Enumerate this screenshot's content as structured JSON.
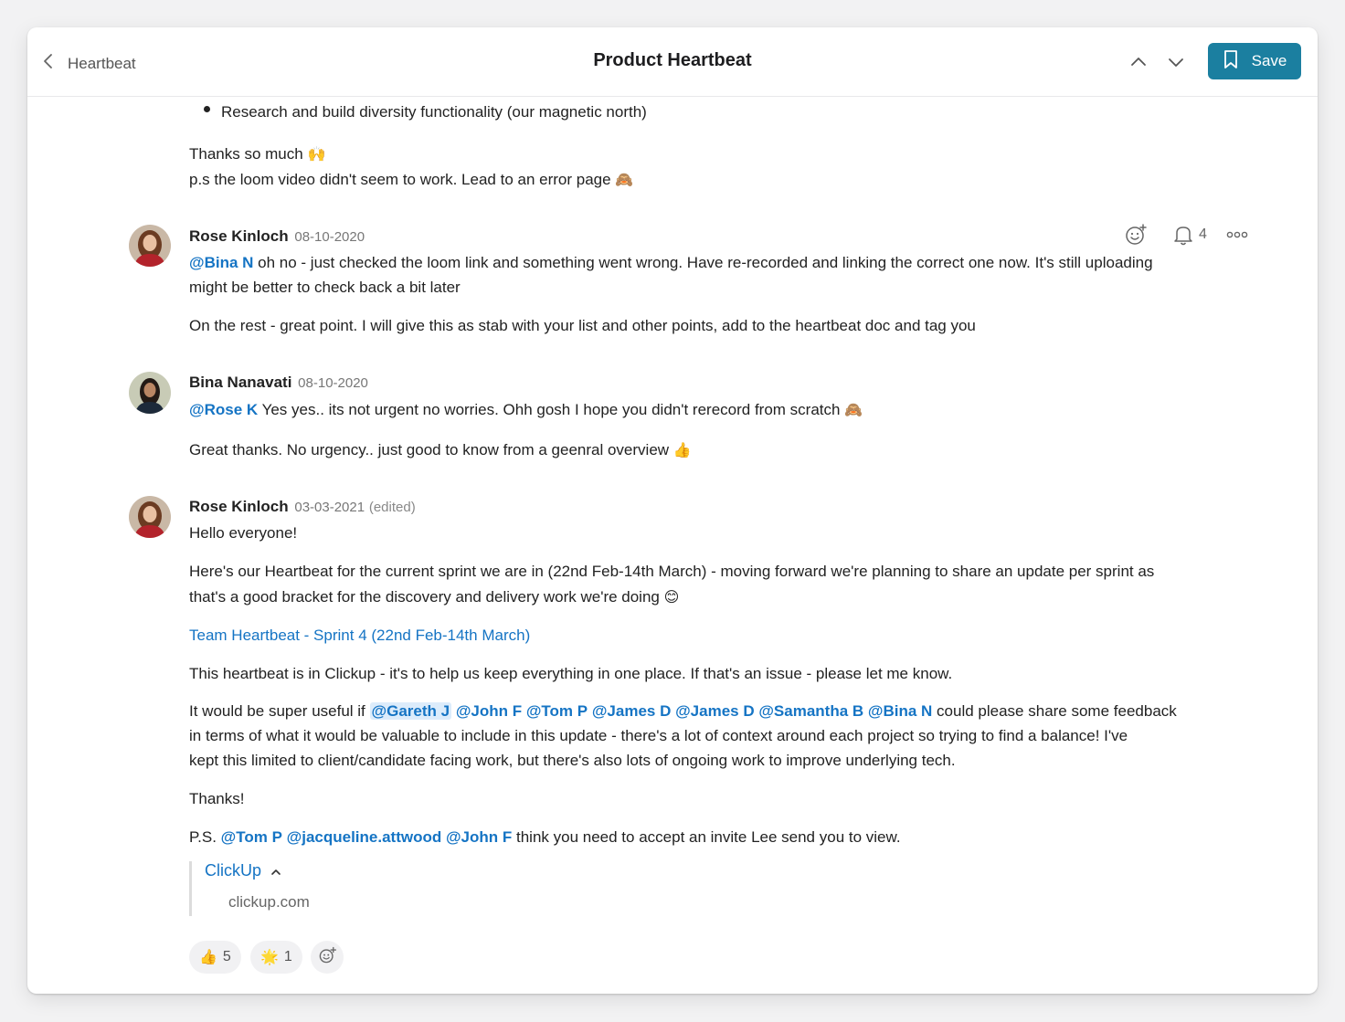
{
  "header": {
    "back_label": "Heartbeat",
    "title": "Product Heartbeat",
    "save_label": "Save"
  },
  "top_block": {
    "bullet": "Research and build diversity functionality (our magnetic north)",
    "line1": "Thanks so much",
    "line1_emoji": "🙌",
    "line2": "p.s the loom video didn't seem to work. Lead to an error page",
    "line2_emoji": "🙈"
  },
  "comments": [
    {
      "author": "Rose Kinloch",
      "date": "08-10-2020",
      "reminder_count": "4",
      "p1_mention": "@Bina N",
      "p1_a": " oh no - just checked the loom link and something went wrong. Have re-recorded and linking the correct one now. It's still uploading",
      "p1_b": "might be better to check back a bit later",
      "p2": "On the rest - great point. I will give this as stab with your list and other points, add to the heartbeat doc and tag you"
    },
    {
      "author": "Bina Nanavati",
      "date": "08-10-2020",
      "p1_mention": "@Rose K",
      "p1_a": " Yes yes.. its not urgent no worries. Ohh gosh I hope you didn't rerecord from scratch",
      "p1_emoji": "🙈",
      "p2": "Great thanks. No urgency.. just good to know from a geenral overview",
      "p2_emoji": "👍"
    },
    {
      "author": "Rose Kinloch",
      "date": "03-03-2021",
      "edited": "(edited)",
      "greeting": "Hello everyone!",
      "p1_a": "Here's our Heartbeat for the current sprint we are in (22nd Feb-14th March) - moving forward we're planning to share an update per sprint as",
      "p1_b": "that's a good bracket for the discovery and delivery work we're doing",
      "p1_emoji": "😊",
      "link": "Team Heartbeat - Sprint 4 (22nd Feb-14th March)",
      "p2": "This heartbeat is in Clickup - it's to help us keep everything in one place. If that's an issue - please let me know.",
      "p3_prefix": "It would be super useful if ",
      "p3_mentions": [
        "@Gareth J",
        "@John F",
        "@Tom P",
        "@James D",
        "@James D",
        "@Samantha B",
        "@Bina N"
      ],
      "p3_suffix": " could please share some feedback",
      "p3_b": "in terms of what it would be valuable to include in this update - there's a lot of context around each project so trying to find a balance! I've",
      "p3_c": "kept this limited to client/candidate facing work, but there's also lots of ongoing work to improve underlying tech.",
      "thanks": "Thanks!",
      "ps_prefix": "P.S. ",
      "ps_mentions": [
        "@Tom P",
        "@jacqueline.attwood",
        "@John F"
      ],
      "ps_suffix": " think you need to accept an invite Lee send you to view.",
      "preview_title": "ClickUp",
      "preview_domain": "clickup.com",
      "reactions": [
        {
          "emoji": "👍",
          "count": "5"
        },
        {
          "emoji": "🌟",
          "count": "1"
        }
      ]
    }
  ],
  "colors": {
    "accent": "#1b7fa0",
    "mention": "#1574c4",
    "mention_highlight": "#dcecfb"
  },
  "icons": [
    "chevron-left-icon",
    "chevron-up-icon",
    "chevron-down-icon",
    "bookmark-icon",
    "add-reaction-icon",
    "bell-icon",
    "more-icon",
    "collapse-chevron-icon"
  ]
}
